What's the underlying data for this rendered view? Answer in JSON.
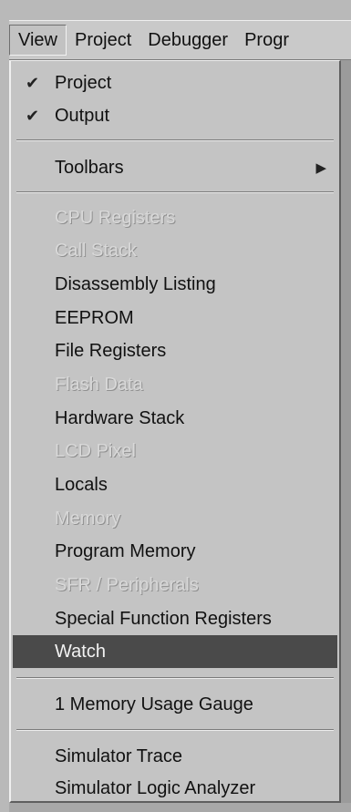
{
  "menubar": {
    "items": [
      {
        "label": "View"
      },
      {
        "label": "Project"
      },
      {
        "label": "Debugger"
      },
      {
        "label": "Progr"
      }
    ]
  },
  "view_menu": {
    "project": "Project",
    "output": "Output",
    "toolbars": "Toolbars",
    "cpu_registers": "CPU Registers",
    "call_stack": "Call Stack",
    "disassembly_listing": "Disassembly Listing",
    "eeprom": "EEPROM",
    "file_registers": "File Registers",
    "flash_data": "Flash Data",
    "hardware_stack": "Hardware Stack",
    "lcd_pixel": "LCD Pixel",
    "locals": "Locals",
    "memory": "Memory",
    "program_memory": "Program Memory",
    "sfr_peripherals": "SFR / Peripherals",
    "special_function_registers": "Special Function Registers",
    "watch": "Watch",
    "memory_usage_gauge": "1 Memory Usage Gauge",
    "simulator_trace": "Simulator Trace",
    "simulator_logic_analyzer": "Simulator Logic Analyzer"
  },
  "icons": {
    "check": "checkmark-icon",
    "submenu_arrow": "submenu-arrow-icon"
  }
}
